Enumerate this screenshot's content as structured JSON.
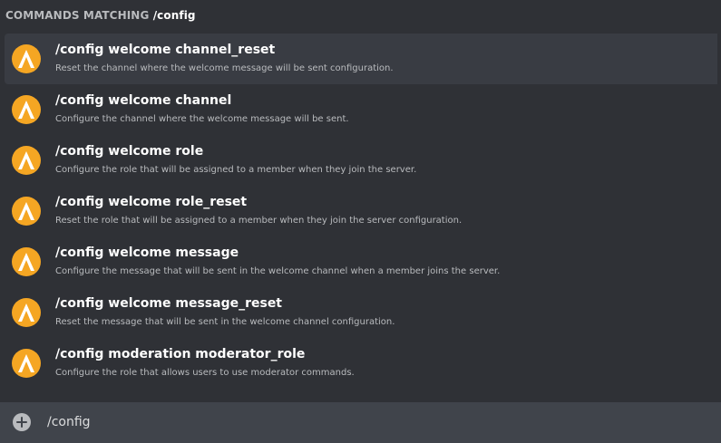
{
  "header": {
    "label": "COMMANDS MATCHING",
    "query": "/config"
  },
  "commands": [
    {
      "name": "/config welcome channel_reset",
      "description": "Reset the channel where the welcome message will be sent configuration.",
      "selected": true
    },
    {
      "name": "/config welcome channel",
      "description": "Configure the channel where the welcome message will be sent.",
      "selected": false
    },
    {
      "name": "/config welcome role",
      "description": "Configure the role that will be assigned to a member when they join the server.",
      "selected": false
    },
    {
      "name": "/config welcome role_reset",
      "description": "Reset the role that will be assigned to a member when they join the server configuration.",
      "selected": false
    },
    {
      "name": "/config welcome message",
      "description": "Configure the message that will be sent in the welcome channel when a member joins the server.",
      "selected": false
    },
    {
      "name": "/config welcome message_reset",
      "description": "Reset the message that will be sent in the welcome channel configuration.",
      "selected": false
    },
    {
      "name": "/config moderation moderator_role",
      "description": "Configure the role that allows users to use moderator commands.",
      "selected": false
    }
  ],
  "bot_avatar_icon": "bot-avatar-icon",
  "input": {
    "value": "/config",
    "add_icon": "plus-circle-icon"
  },
  "colors": {
    "background": "#2f3136",
    "selected_row": "#393c43",
    "input_bar": "#40444b",
    "avatar": "#f5a623"
  }
}
